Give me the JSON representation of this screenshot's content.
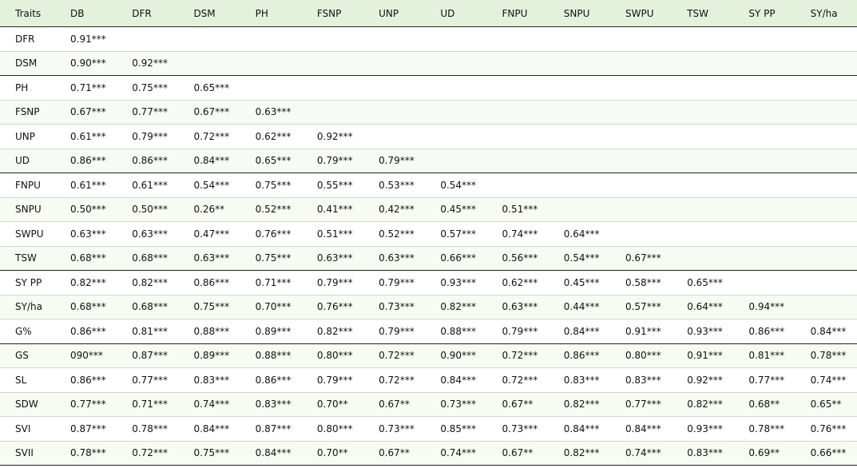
{
  "table": {
    "headers": [
      "Traits",
      "DB",
      "DFR",
      "DSM",
      "PH",
      "FSNP",
      "UNP",
      "UD",
      "FNPU",
      "SNPU",
      "SWPU",
      "TSW",
      "SY PP",
      "SY/ha"
    ],
    "rows": [
      [
        "DFR",
        "0.91***",
        "",
        "",
        "",
        "",
        "",
        "",
        "",
        "",
        "",
        "",
        "",
        ""
      ],
      [
        "DSM",
        "0.90***",
        "0.92***",
        "",
        "",
        "",
        "",
        "",
        "",
        "",
        "",
        "",
        "",
        ""
      ],
      [
        "PH",
        "0.71***",
        "0.75***",
        "0.65***",
        "",
        "",
        "",
        "",
        "",
        "",
        "",
        "",
        "",
        ""
      ],
      [
        "FSNP",
        "0.67***",
        "0.77***",
        "0.67***",
        "0.63***",
        "",
        "",
        "",
        "",
        "",
        "",
        "",
        "",
        ""
      ],
      [
        "UNP",
        "0.61***",
        "0.79***",
        "0.72***",
        "0.62***",
        "0.92***",
        "",
        "",
        "",
        "",
        "",
        "",
        "",
        ""
      ],
      [
        "UD",
        "0.86***",
        "0.86***",
        "0.84***",
        "0.65***",
        "0.79***",
        "0.79***",
        "",
        "",
        "",
        "",
        "",
        "",
        ""
      ],
      [
        "FNPU",
        "0.61***",
        "0.61***",
        "0.54***",
        "0.75***",
        "0.55***",
        "0.53***",
        "0.54***",
        "",
        "",
        "",
        "",
        "",
        ""
      ],
      [
        "SNPU",
        "0.50***",
        "0.50***",
        "0.26**",
        "0.52***",
        "0.41***",
        "0.42***",
        "0.45***",
        "0.51***",
        "",
        "",
        "",
        "",
        ""
      ],
      [
        "SWPU",
        "0.63***",
        "0.63***",
        "0.47***",
        "0.76***",
        "0.51***",
        "0.52***",
        "0.57***",
        "0.74***",
        "0.64***",
        "",
        "",
        "",
        ""
      ],
      [
        "TSW",
        "0.68***",
        "0.68***",
        "0.63***",
        "0.75***",
        "0.63***",
        "0.63***",
        "0.66***",
        "0.56***",
        "0.54***",
        "0.67***",
        "",
        "",
        ""
      ],
      [
        "SY PP",
        "0.82***",
        "0.82***",
        "0.86***",
        "0.71***",
        "0.79***",
        "0.79***",
        "0.93***",
        "0.62***",
        "0.45***",
        "0.58***",
        "0.65***",
        "",
        ""
      ],
      [
        "SY/ha",
        "0.68***",
        "0.68***",
        "0.75***",
        "0.70***",
        "0.76***",
        "0.73***",
        "0.82***",
        "0.63***",
        "0.44***",
        "0.57***",
        "0.64***",
        "0.94***",
        ""
      ],
      [
        "G%",
        "0.86***",
        "0.81***",
        "0.88***",
        "0.89***",
        "0.82***",
        "0.79***",
        "0.88***",
        "0.79***",
        "0.84***",
        "0.91***",
        "0.93***",
        "0.86***",
        "0.84***"
      ],
      [
        "GS",
        "090***",
        "0.87***",
        "0.89***",
        "0.88***",
        "0.80***",
        "0.72***",
        "0.90***",
        "0.72***",
        "0.86***",
        "0.80***",
        "0.91***",
        "0.81***",
        "0.78***"
      ],
      [
        "SL",
        "0.86***",
        "0.77***",
        "0.83***",
        "0.86***",
        "0.79***",
        "0.72***",
        "0.84***",
        "0.72***",
        "0.83***",
        "0.83***",
        "0.92***",
        "0.77***",
        "0.74***"
      ],
      [
        "SDW",
        "0.77***",
        "0.71***",
        "0.74***",
        "0.83***",
        "0.70**",
        "0.67**",
        "0.73***",
        "0.67**",
        "0.82***",
        "0.77***",
        "0.82***",
        "0.68**",
        "0.65**"
      ],
      [
        "SVI",
        "0.87***",
        "0.78***",
        "0.84***",
        "0.87***",
        "0.80***",
        "0.73***",
        "0.85***",
        "0.73***",
        "0.84***",
        "0.84***",
        "0.93***",
        "0.78***",
        "0.76***"
      ],
      [
        "SVII",
        "0.78***",
        "0.72***",
        "0.75***",
        "0.84***",
        "0.70**",
        "0.67**",
        "0.74***",
        "0.67**",
        "0.82***",
        "0.74***",
        "0.83***",
        "0.69**",
        "0.66***"
      ]
    ]
  }
}
